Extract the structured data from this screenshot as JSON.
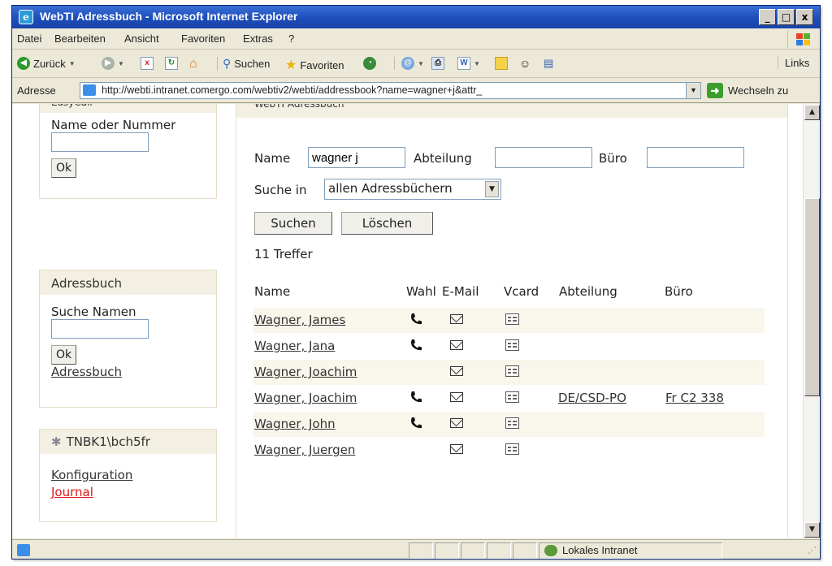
{
  "window": {
    "title": "WebTI Adressbuch - Microsoft Internet Explorer",
    "buttons": [
      "_",
      "□",
      "x"
    ]
  },
  "menu": [
    "Datei",
    "Bearbeiten",
    "Ansicht",
    "Favoriten",
    "Extras",
    "?"
  ],
  "toolbar": {
    "back": "Zurück",
    "search": "Suchen",
    "favorites": "Favoriten",
    "links": "Links"
  },
  "address": {
    "label": "Adresse",
    "url": "http://webti.intranet.comergo.com/webtiv2/webti/addressbook?name=wagner+j&attr_",
    "go": "Wechseln zu"
  },
  "easycall": {
    "title": "EasyCall",
    "label": "Name oder Nummer",
    "value": "",
    "ok": "Ok"
  },
  "addressbook_box": {
    "title": "Adressbuch",
    "label": "Suche Namen",
    "value": "",
    "ok": "Ok",
    "link": "Adressbuch"
  },
  "user_box": {
    "title": "TNBK1\\bch5fr",
    "config": "Konfiguration",
    "journal": "Journal"
  },
  "main": {
    "title": "WebTI Adressbuch",
    "name_label": "Name",
    "name_value": "wagner j",
    "dept_label": "Abteilung",
    "dept_value": "",
    "office_label": "Büro",
    "office_value": "",
    "search_in_label": "Suche in",
    "search_in_value": "allen Adressbüchern",
    "search_button": "Suchen",
    "clear_button": "Löschen",
    "result_count": "11 Treffer",
    "columns": [
      "Name",
      "Wahl",
      "E-Mail",
      "Vcard",
      "Abteilung",
      "Büro"
    ]
  },
  "results": [
    {
      "name": "Wagner, James",
      "phone": true,
      "email": true,
      "vcard": true,
      "dept": "",
      "office": ""
    },
    {
      "name": "Wagner, Jana",
      "phone": true,
      "email": true,
      "vcard": true,
      "dept": "",
      "office": ""
    },
    {
      "name": "Wagner, Joachim",
      "phone": false,
      "email": true,
      "vcard": true,
      "dept": "",
      "office": ""
    },
    {
      "name": "Wagner, Joachim",
      "phone": true,
      "email": true,
      "vcard": true,
      "dept": "DE/CSD-PO",
      "office": "Fr C2 338"
    },
    {
      "name": "Wagner, John",
      "phone": true,
      "email": true,
      "vcard": true,
      "dept": "",
      "office": ""
    },
    {
      "name": "Wagner, Juergen",
      "phone": false,
      "email": true,
      "vcard": true,
      "dept": "",
      "office": ""
    }
  ],
  "status": {
    "zone": "Lokales Intranet"
  }
}
